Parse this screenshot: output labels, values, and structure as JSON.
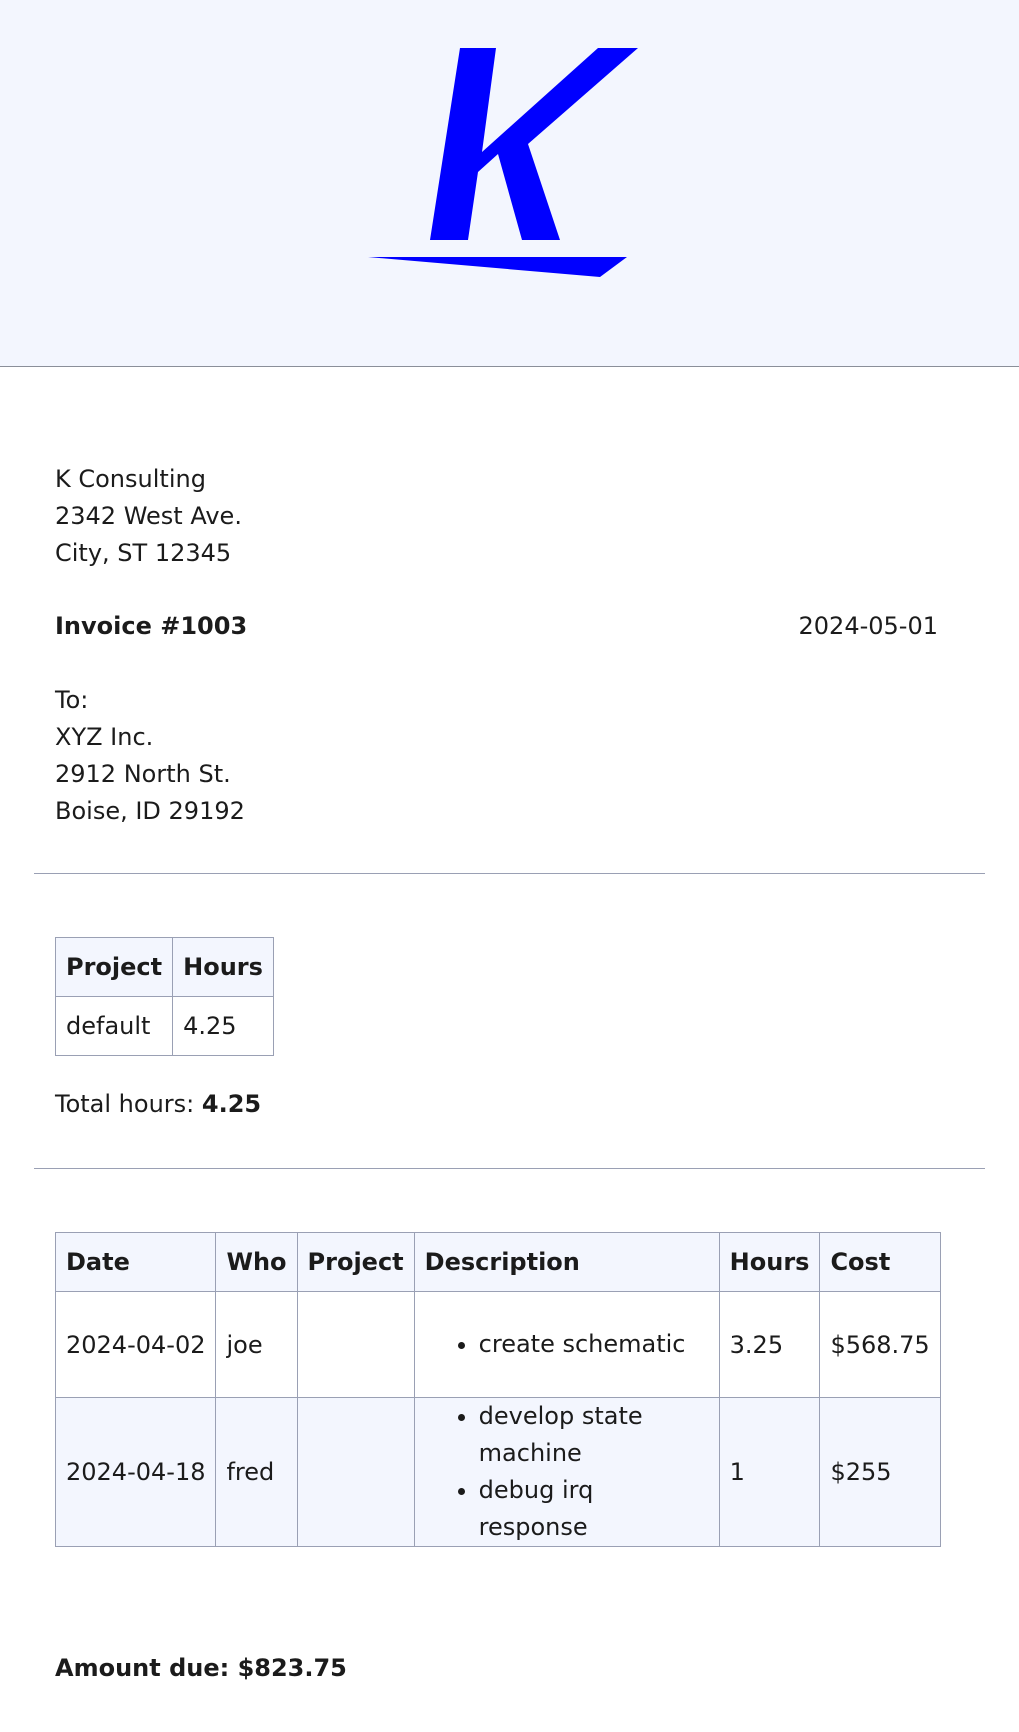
{
  "logo": {
    "letter": "K",
    "color": "#0000ff"
  },
  "from": {
    "name": "K Consulting",
    "address1": "2342 West Ave.",
    "address2": "City, ST 12345"
  },
  "invoice": {
    "number": "Invoice #1003",
    "date": "2024-05-01"
  },
  "to": {
    "label": "To:",
    "name": "XYZ Inc.",
    "address1": "2912 North St.",
    "address2": "Boise, ID 29192"
  },
  "summary": {
    "headers": [
      "Project",
      "Hours"
    ],
    "rows": [
      [
        "default",
        "4.25"
      ]
    ],
    "total_label": "Total hours:",
    "total_value": "4.25"
  },
  "entries": {
    "headers": [
      "Date",
      "Who",
      "Project",
      "Description",
      "Hours",
      "Cost"
    ],
    "rows": [
      {
        "date": "2024-04-02",
        "who": "joe",
        "project": "",
        "description": [
          "create schematic"
        ],
        "hours": "3.25",
        "cost": "$568.75"
      },
      {
        "date": "2024-04-18",
        "who": "fred",
        "project": "",
        "description": [
          "develop state machine",
          "debug irq response"
        ],
        "hours": "1",
        "cost": "$255"
      }
    ]
  },
  "amount_due": "Amount due: $823.75"
}
